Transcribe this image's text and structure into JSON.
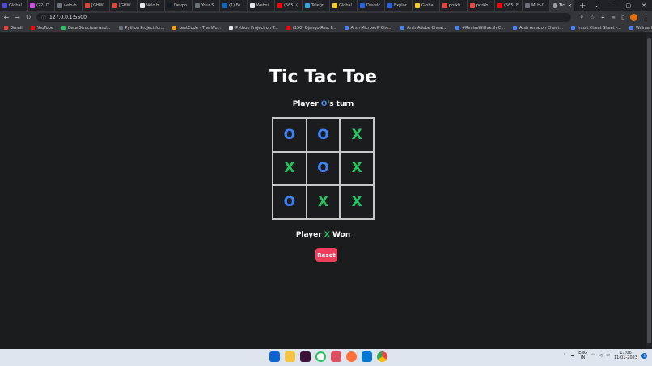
{
  "browser": {
    "tabs": [
      {
        "label": "Global",
        "color": "#4f46e5"
      },
      {
        "label": "(22) D",
        "color": "#d946ef"
      },
      {
        "label": "velo-b",
        "color": "#6b7280"
      },
      {
        "label": "[GHW",
        "color": "#ea4335"
      },
      {
        "label": "[GHW",
        "color": "#ea4335"
      },
      {
        "label": "Velo b",
        "color": "#e5e7eb"
      },
      {
        "label": "Devpo",
        "color": "#111827"
      },
      {
        "label": "Your S",
        "color": "#6b7280"
      },
      {
        "label": "(1) Fe",
        "color": "#0a66c2"
      },
      {
        "label": "Websi",
        "color": "#e5e7eb"
      },
      {
        "label": "(565) (",
        "color": "#ff0000"
      },
      {
        "label": "Telegr",
        "color": "#2aabee"
      },
      {
        "label": "Global",
        "color": "#facc15"
      },
      {
        "label": "Develc",
        "color": "#2563eb"
      },
      {
        "label": "Explor",
        "color": "#2563eb"
      },
      {
        "label": "Global",
        "color": "#facc15"
      },
      {
        "label": "porkb",
        "color": "#ea4335"
      },
      {
        "label": "porkb",
        "color": "#ef4444"
      },
      {
        "label": "(565) F",
        "color": "#ff0000"
      },
      {
        "label": "MLH-C",
        "color": "#6b7280"
      }
    ],
    "active_tab": {
      "label": "Tic"
    },
    "address": "127.0.0.1:5500",
    "bookmarks": [
      {
        "label": "Gmail",
        "color": "#ea4335"
      },
      {
        "label": "YouTube",
        "color": "#ff0000"
      },
      {
        "label": "Data Structure and...",
        "color": "#22c55e"
      },
      {
        "label": "Python Project for...",
        "color": "#6b7280"
      },
      {
        "label": "LeetCode - The Wo...",
        "color": "#f59e0b"
      },
      {
        "label": "Python Project on T...",
        "color": "#e5e7eb"
      },
      {
        "label": "(150) Django Rest F...",
        "color": "#ff0000"
      },
      {
        "label": "Arsh Microsoft Che...",
        "color": "#4285f4"
      },
      {
        "label": "Arsh Adobe Cheat...",
        "color": "#4285f4"
      },
      {
        "label": "#ReviseWithArsh C...",
        "color": "#4285f4"
      },
      {
        "label": "Arsh Amazon Cheat...",
        "color": "#4285f4"
      },
      {
        "label": "Intuit Cheat Sheet -...",
        "color": "#4285f4"
      },
      {
        "label": "Walmart Cheat She...",
        "color": "#4285f4"
      }
    ]
  },
  "game": {
    "title": "Tic Tac Toe",
    "turn_prefix": "Player ",
    "turn_player": "O",
    "turn_suffix": "'s turn",
    "board": [
      "O",
      "O",
      "X",
      "X",
      "O",
      "X",
      "O",
      "X",
      "X"
    ],
    "result_prefix": "Player ",
    "result_player": "X",
    "result_suffix": " Won",
    "reset_label": "Reset",
    "colors": {
      "o": "#3b82f6",
      "x": "#22c55e",
      "reset": "#ef3e5c"
    }
  },
  "taskbar": {
    "lang_top": "ENG",
    "lang_bottom": "IN",
    "time": "17:06",
    "date": "11-01-2023",
    "notifications": "3"
  }
}
